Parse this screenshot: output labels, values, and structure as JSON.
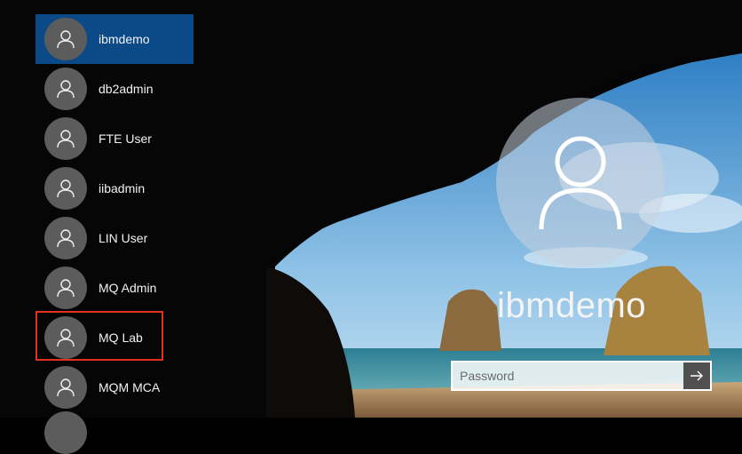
{
  "users": [
    {
      "name": "ibmdemo",
      "selected": true
    },
    {
      "name": "db2admin",
      "selected": false
    },
    {
      "name": "FTE User",
      "selected": false
    },
    {
      "name": "iibadmin",
      "selected": false
    },
    {
      "name": "LIN User",
      "selected": false
    },
    {
      "name": "MQ Admin",
      "selected": false
    },
    {
      "name": "MQ Lab",
      "selected": false
    },
    {
      "name": "MQM MCA",
      "selected": false
    }
  ],
  "current_user": {
    "name": "ibmdemo",
    "icon": "user-avatar-icon"
  },
  "password": {
    "placeholder": "Password",
    "value": ""
  },
  "submit": {
    "icon": "arrow-right-icon"
  },
  "colors": {
    "selected_bg": "#0b4a86",
    "highlight_border": "#e0321d",
    "avatar_bg": "#5c5c5c"
  }
}
